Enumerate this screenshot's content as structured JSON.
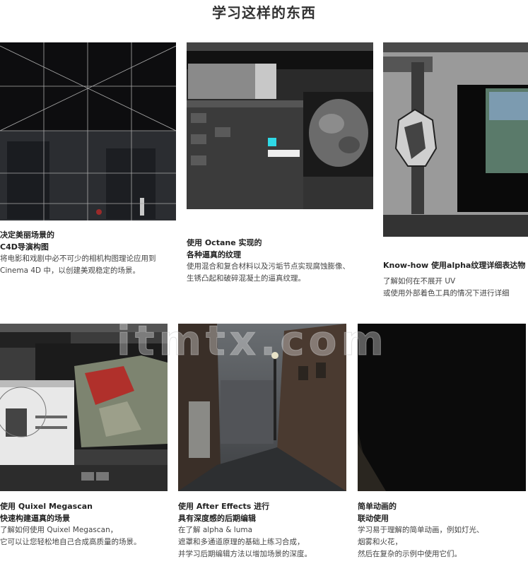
{
  "section_title": "学习这样的东西",
  "watermark": "itmtx.com",
  "cards": [
    {
      "heading1": "决定美丽场景的",
      "heading2": "C4D导演构图",
      "desc1": "将电影和戏剧中必不可少的相机构图理论应用到",
      "desc2": "Cinema 4D 中，以创建美观稳定的场景。"
    },
    {
      "heading1": "使用 Octane 实现的",
      "heading2": "各种逼真的纹理",
      "desc1": "使用混合和复合材料以及污垢节点实现腐蚀膨像、",
      "desc2": "生锈凸起和破碎混凝土的逼真纹理。"
    },
    {
      "heading1": "Know-how 使用alpha纹理详细表达物",
      "heading2": "",
      "desc1": "了解如何在不展开 UV",
      "desc2": "或使用外部着色工具的情况下进行详细"
    },
    {
      "heading1": "使用 Quixel Megascan",
      "heading2": "快速构建逼真的场景",
      "desc1": "了解如何使用 Quixel Megascan，",
      "desc2": "它可以让您轻松地自己合成高质量的场景。"
    },
    {
      "heading1": "使用 After Effects 进行",
      "heading2": "具有深度感的后期编辑",
      "desc1": "在了解 alpha & luma",
      "desc2": "遮罩和多通道原理的基础上练习合成，",
      "desc3": "并学习后期编辑方法以增加场景的深度。"
    },
    {
      "heading1": "简单动画的",
      "heading2": "联动使用",
      "desc1": "学习易于理解的简单动画，例如灯光、",
      "desc2": "烟雾和火花，",
      "desc3": "然后在复杂的示例中使用它们。"
    }
  ]
}
